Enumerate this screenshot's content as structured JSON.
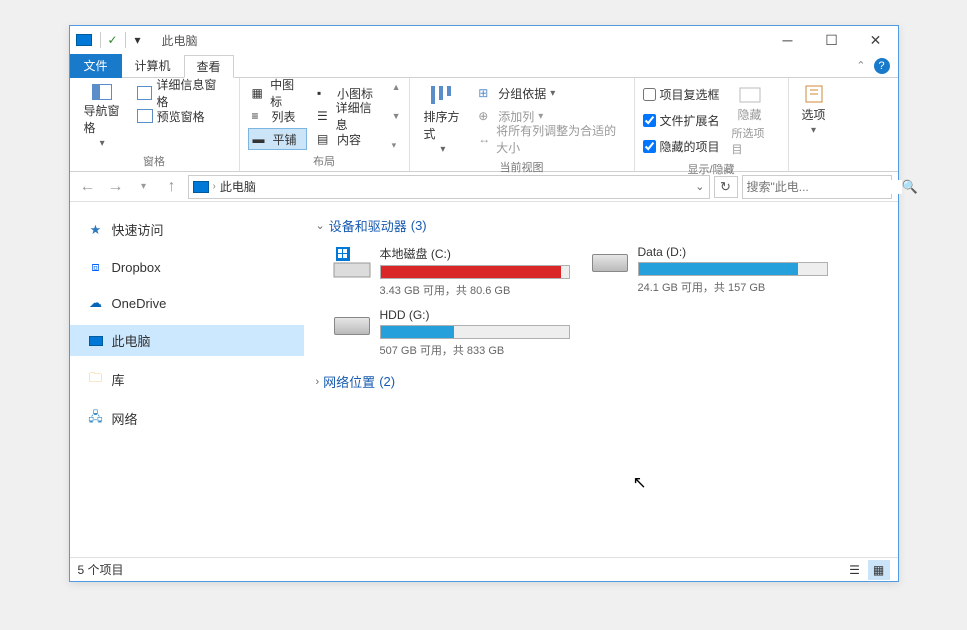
{
  "window": {
    "title": "此电脑"
  },
  "qat": {
    "check": "✓"
  },
  "tabs": {
    "file": "文件",
    "computer": "计算机",
    "view": "查看"
  },
  "ribbon": {
    "group_pane": {
      "nav_pane": "导航窗格",
      "preview_pane": "预览窗格",
      "detail_pane": "详细信息窗格",
      "label": "窗格"
    },
    "group_layout": {
      "medium": "中图标",
      "small": "小图标",
      "list": "列表",
      "details": "详细信息",
      "tiles": "平铺",
      "content": "内容",
      "label": "布局"
    },
    "group_current": {
      "sort": "排序方式",
      "group_by": "分组依据",
      "add_cols": "添加列",
      "fit_cols": "将所有列调整为合适的大小",
      "label": "当前视图"
    },
    "group_show": {
      "chk1": "项目复选框",
      "chk2": "文件扩展名",
      "chk3": "隐藏的项目",
      "hide": "隐藏",
      "hide_sub": "所选项目",
      "label": "显示/隐藏"
    },
    "options": "选项"
  },
  "address": {
    "path": "此电脑"
  },
  "search": {
    "placeholder": "搜索\"此电..."
  },
  "sidebar": {
    "items": [
      {
        "label": "快速访问"
      },
      {
        "label": "Dropbox"
      },
      {
        "label": "OneDrive"
      },
      {
        "label": "此电脑"
      },
      {
        "label": "库"
      },
      {
        "label": "网络"
      }
    ]
  },
  "content": {
    "section1": {
      "title": "设备和驱动器",
      "count": "(3)"
    },
    "section2": {
      "title": "网络位置",
      "count": "(2)"
    },
    "drives": [
      {
        "name": "本地磁盘 (C:)",
        "free": "3.43 GB 可用，共 80.6 GB",
        "fill_pct": 96,
        "color": "red",
        "os": true
      },
      {
        "name": "Data (D:)",
        "free": "24.1 GB 可用，共 157 GB",
        "fill_pct": 85,
        "color": "blue",
        "os": false
      },
      {
        "name": "HDD (G:)",
        "free": "507 GB 可用，共 833 GB",
        "fill_pct": 39,
        "color": "blue",
        "os": false
      }
    ]
  },
  "statusbar": {
    "text": "5 个项目"
  }
}
